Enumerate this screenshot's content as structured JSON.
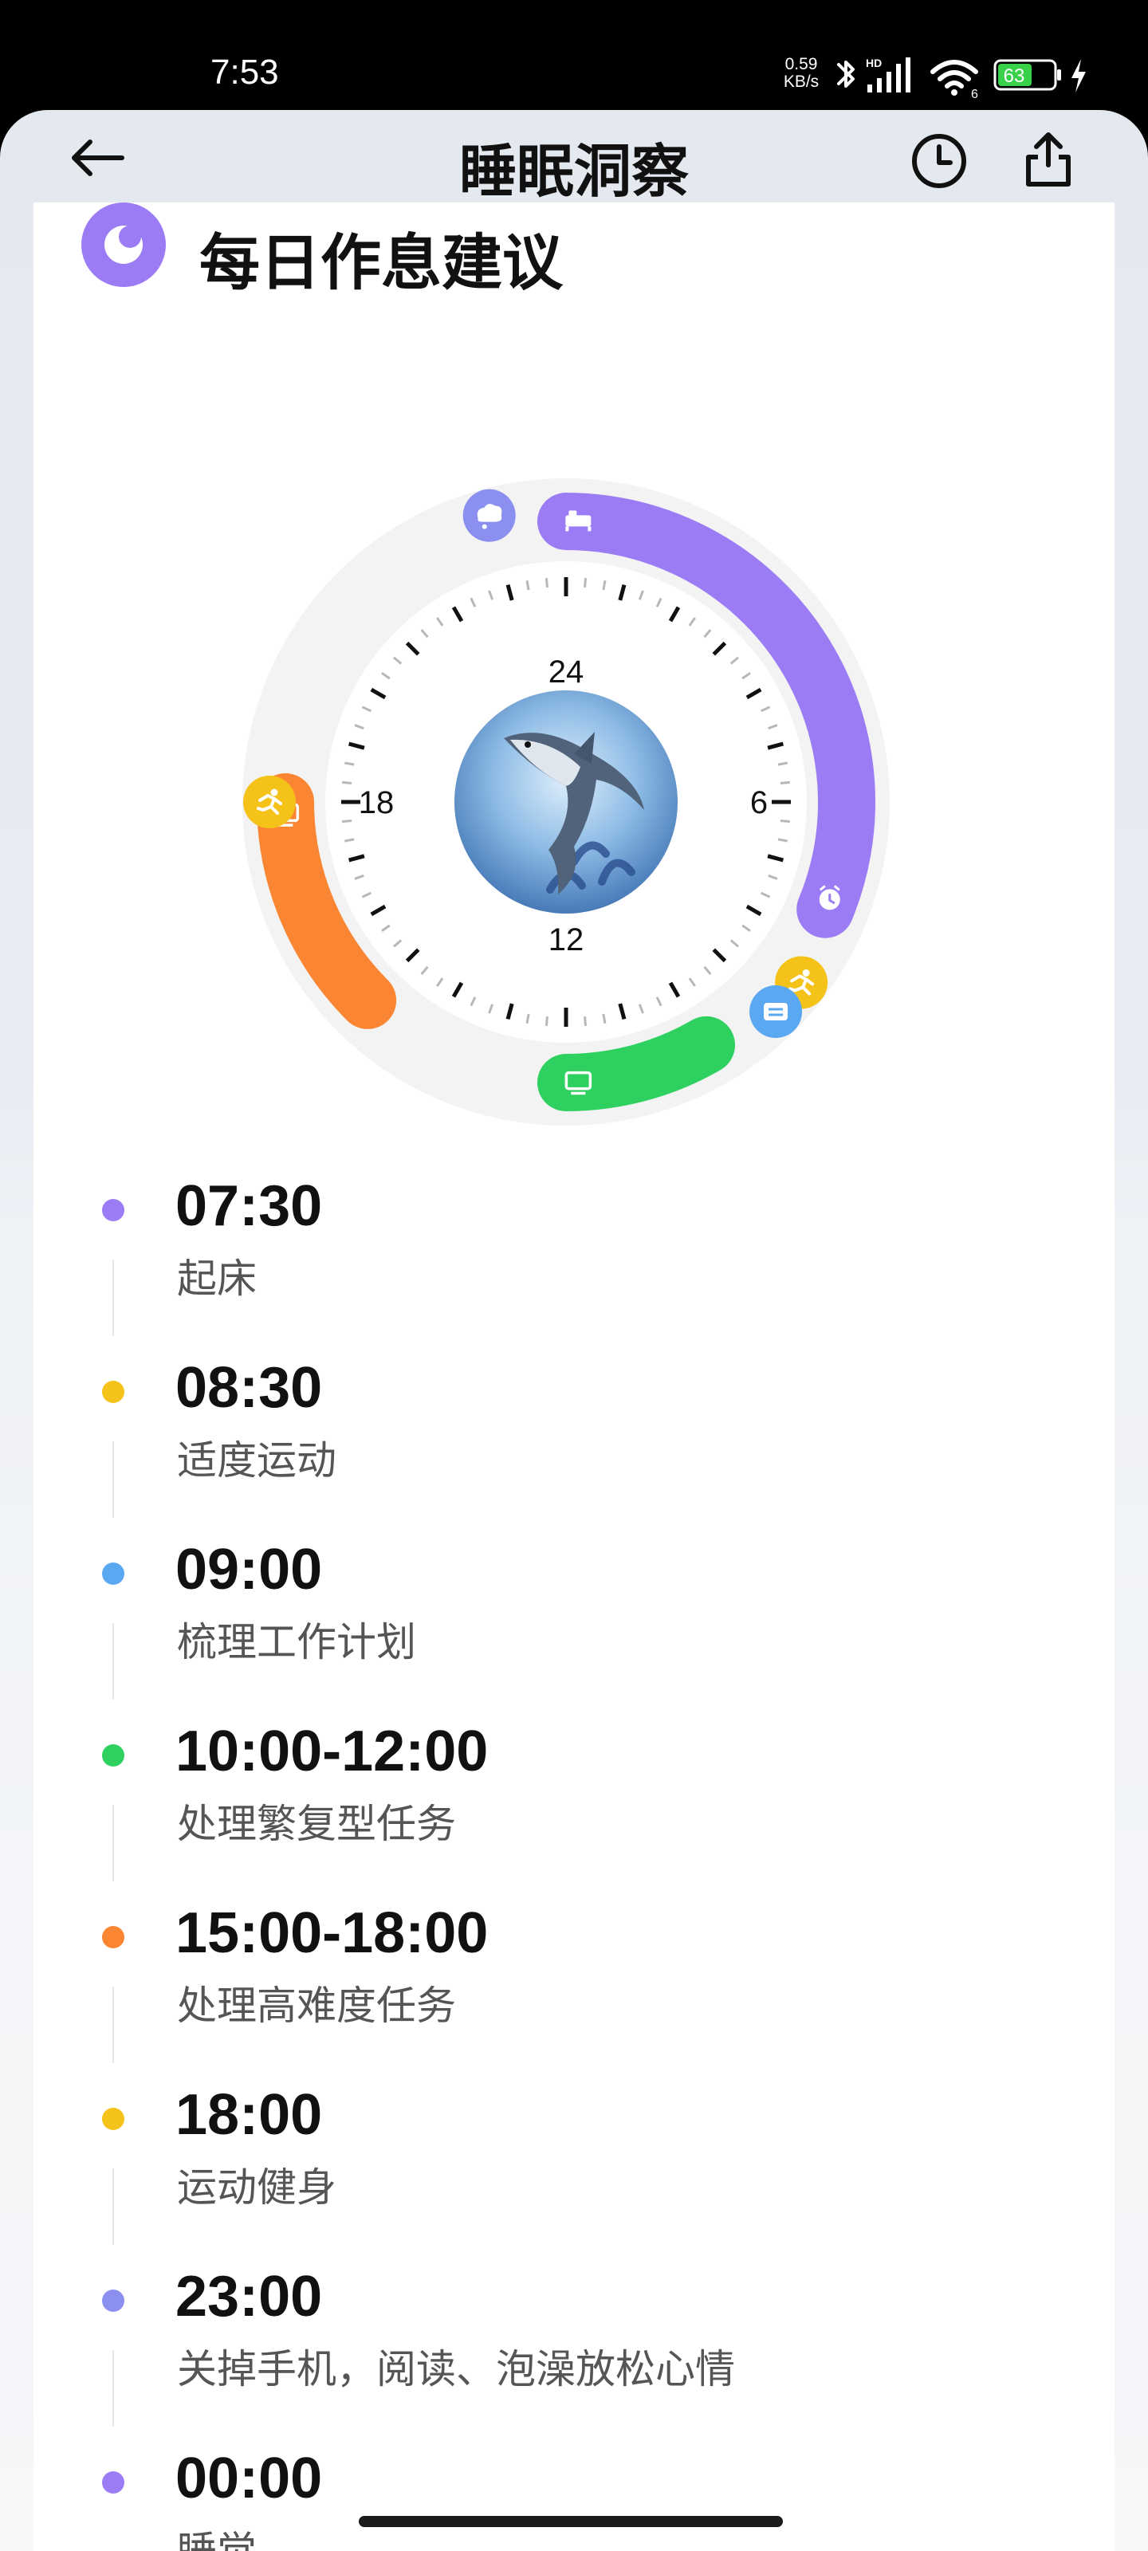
{
  "status_bar": {
    "time": "7:53",
    "net_speed_value": "0.59",
    "net_speed_unit": "KB/s",
    "signal_label": "HD",
    "wifi_label": "6",
    "battery_level": "63",
    "battery_color": "#3ad14a"
  },
  "header": {
    "title": "睡眠洞察",
    "back_icon": "back-arrow-icon",
    "history_icon": "clock-history-icon",
    "share_icon": "share-icon"
  },
  "section": {
    "title": "每日作息建议",
    "icon": "moon-icon",
    "accent": "#9b7cf4"
  },
  "clock": {
    "hour_labels": [
      "24",
      "6",
      "12",
      "18"
    ],
    "center_image": "shark-illustration",
    "arcs": [
      {
        "name": "sleep",
        "start": "00:00",
        "end": "07:30",
        "color": "#9b7cf4",
        "start_icon": "bed-icon",
        "end_icon": "alarm-clock-icon"
      },
      {
        "name": "routine-tasks",
        "start": "10:00",
        "end": "12:00",
        "color": "#2ed160",
        "icon": "monitor-icon"
      },
      {
        "name": "hard-tasks",
        "start": "15:00",
        "end": "18:00",
        "color": "#fa8532",
        "icon": "monitor-icon"
      }
    ],
    "markers": [
      {
        "name": "exercise-morning",
        "time": "08:30",
        "color": "#f5c21a",
        "icon": "running-icon"
      },
      {
        "name": "plan-work",
        "time": "09:00",
        "color": "#5aa8f2",
        "icon": "list-icon"
      },
      {
        "name": "exercise-evening",
        "time": "18:00",
        "color": "#f5c21a",
        "icon": "running-icon"
      },
      {
        "name": "relax",
        "time": "23:00",
        "color": "#8a8ff0",
        "icon": "thought-bubble-icon"
      }
    ]
  },
  "schedule": [
    {
      "time": "07:30",
      "desc": "起床",
      "color": "#9b7cf4"
    },
    {
      "time": "08:30",
      "desc": "适度运动",
      "color": "#f5c21a"
    },
    {
      "time": "09:00",
      "desc": "梳理工作计划",
      "color": "#5aa8f2"
    },
    {
      "time": "10:00-12:00",
      "desc": "处理繁复型任务",
      "color": "#2ed160"
    },
    {
      "time": "15:00-18:00",
      "desc": "处理高难度任务",
      "color": "#fa8532"
    },
    {
      "time": "18:00",
      "desc": "运动健身",
      "color": "#f5c21a"
    },
    {
      "time": "23:00",
      "desc": "关掉手机，阅读、泡澡放松心情",
      "color": "#8a8ff0"
    },
    {
      "time": "00:00",
      "desc": "睡觉",
      "color": "#9b7cf4"
    }
  ]
}
